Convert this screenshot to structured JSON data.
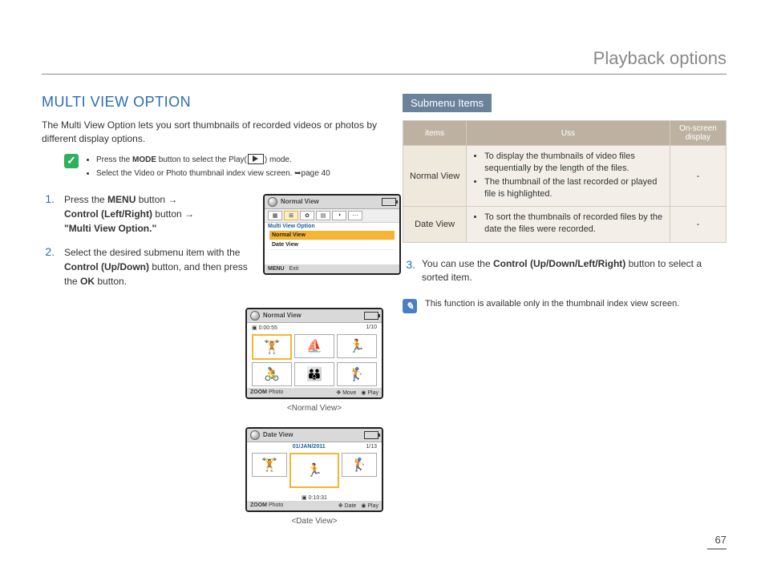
{
  "header_title": "Playback options",
  "section_title": "MULTI VIEW OPTION",
  "intro": "The Multi View Option lets you sort thumbnails of recorded videos or photos by different display options.",
  "prereq": {
    "line1_a": "Press the ",
    "line1_bold": "MODE",
    "line1_b": " button to select the Play(",
    "line1_c": ") mode.",
    "line2": "Select the Video or Photo thumbnail index view screen. ➥page 40"
  },
  "steps": {
    "s1": {
      "num": "1.",
      "a": "Press the ",
      "b1": "MENU",
      "b2": " button → ",
      "c1": "Control (Left/Right)",
      "c2": " button → ",
      "d": "\"Multi View Option.\""
    },
    "s2": {
      "num": "2.",
      "a": "Select the desired submenu item with the ",
      "b": "Control (Up/Down)",
      "c": " button, and then press the ",
      "d": "OK",
      "e": " button."
    },
    "s3": {
      "num": "3.",
      "a": "You can use the ",
      "b": "Control (Up/Down/Left/Right)",
      "c": " button to select a sorted item."
    }
  },
  "screen1": {
    "title": "Normal View",
    "menu_label": "Multi View Option",
    "items": [
      "Normal View",
      "Date View"
    ],
    "footer_menu": "MENU",
    "footer_exit": "Exit"
  },
  "screen2": {
    "title": "Normal View",
    "time": "0:00:55",
    "count": "1/10",
    "footer_zoom": "ZOOM",
    "footer_photo": "Photo",
    "footer_move": "Move",
    "footer_play": "Play"
  },
  "screen2_caption": "<Normal View>",
  "screen3": {
    "title": "Date View",
    "date": "01/JAN/2011",
    "count": "1/13",
    "clip_time": "0:10:31",
    "footer_zoom": "ZOOM",
    "footer_photo": "Photo",
    "footer_date": "Date",
    "footer_play": "Play"
  },
  "screen3_caption": "<Date View>",
  "submenu_heading": "Submenu Items",
  "table": {
    "h_items": "items",
    "h_uss": "Uss",
    "h_osd": "On-screen display",
    "rows": [
      {
        "name": "Normal View",
        "b1": "To display the thumbnails of video files sequentially by the length of the files.",
        "b2": "The thumbnail of the last recorded or played file is highlighted.",
        "osd": "-"
      },
      {
        "name": "Date View",
        "b1": "To sort the thumbnails of recorded files by the date the files were recorded.",
        "osd": "-"
      }
    ]
  },
  "note2": "This function is available only in the thumbnail index view screen.",
  "page_num": "67"
}
